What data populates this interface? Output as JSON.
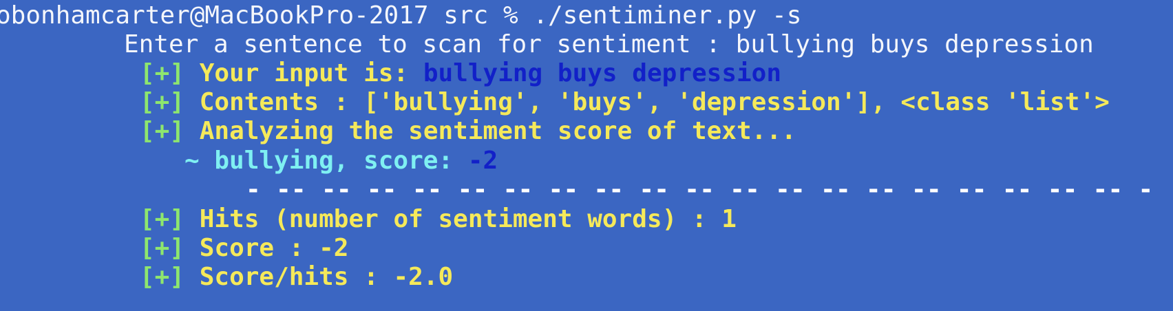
{
  "prompt": {
    "user_host": "obonhamcarter@MacBookPro-2017",
    "cwd": "src",
    "symbol": "%",
    "command": "./sentiminer.py -s"
  },
  "input_prompt": {
    "label": "Enter a sentence to scan for sentiment :",
    "value": "bullying buys depression"
  },
  "tag": "[+]",
  "input_echo": {
    "label": "Your input is:",
    "value": "bullying buys depression"
  },
  "contents": {
    "text": "Contents : ['bullying', 'buys', 'depression'], <class 'list'>"
  },
  "analyzing": {
    "text": "Analyzing the sentiment score of text..."
  },
  "word_score": {
    "prefix": "~ bullying, score:",
    "value": "-2"
  },
  "separator": "- -- -- -- -- -- -- -- -- -- -- -- -- -- -- -- -- -- -- -- -",
  "hits": {
    "text": "Hits (number of sentiment words) : 1"
  },
  "score": {
    "text": "Score : -2"
  },
  "score_hits": {
    "text": "Score/hits : -2.0"
  },
  "colors": {
    "background": "#3b66c2",
    "prompt_text": "#f4f6fb",
    "yellow": "#f5e95a",
    "green": "#8ee66e",
    "cyan": "#7ff0f2",
    "dark_blue": "#1220c8"
  }
}
